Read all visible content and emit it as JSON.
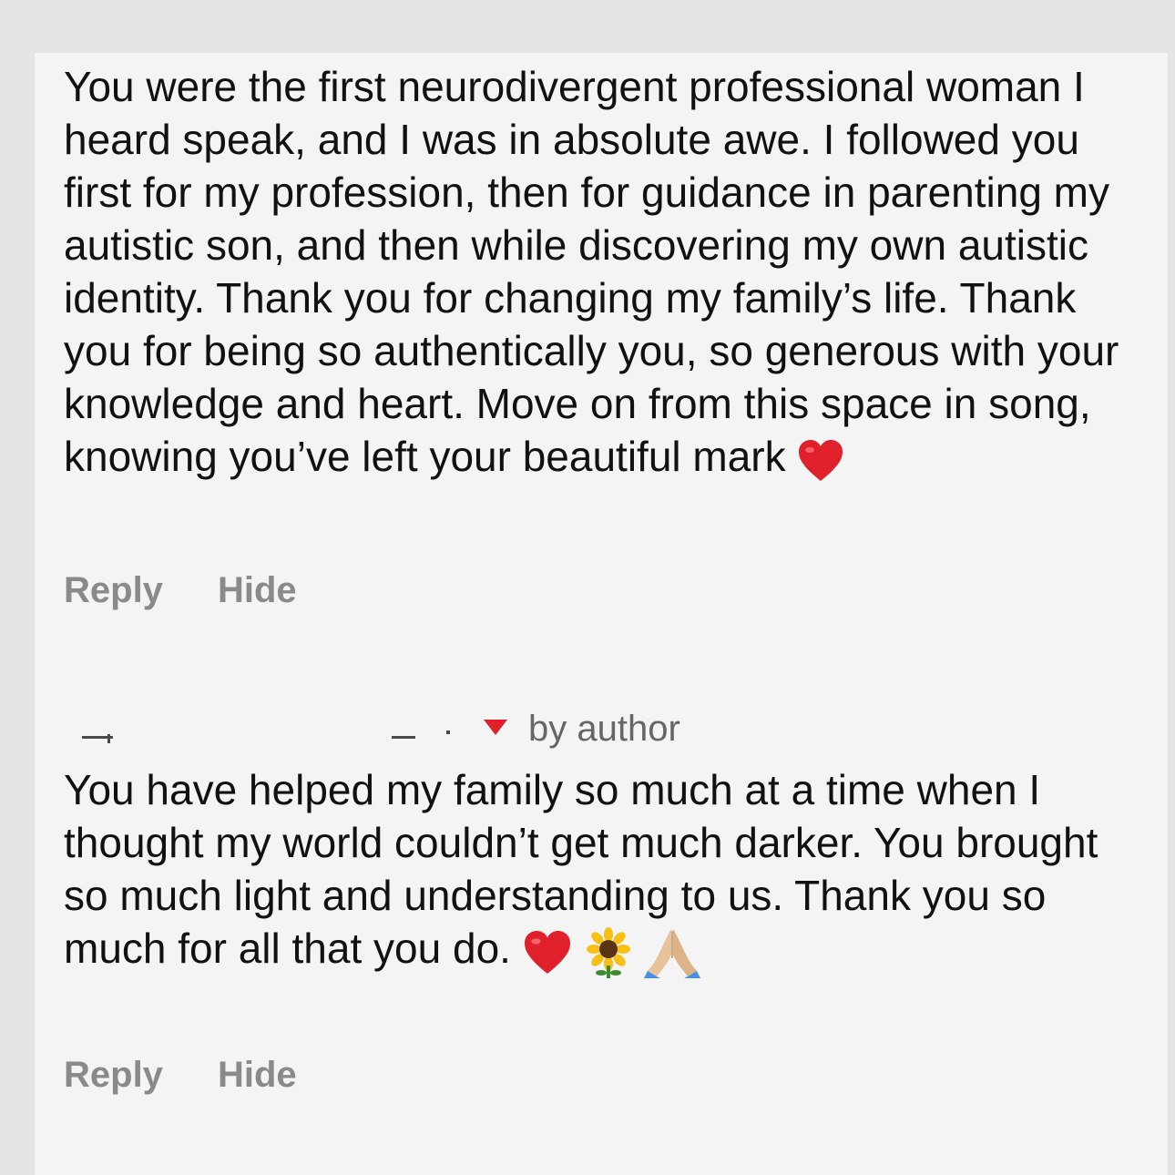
{
  "comments": [
    {
      "text": "You were the first neurodivergent professional woman I heard speak, and I was in absolute awe. I followed you first for my profession, then for guidance in parenting my autistic son, and then while discovering my own autistic identity. Thank you for changing my family’s life. Thank you for being so authentically you, so generous with your knowledge and heart. Move on from this space in song, knowing you’ve left your beautiful mark",
      "emojis": [
        "red-heart"
      ],
      "reply_label": "Reply",
      "hide_label": "Hide"
    },
    {
      "liked_by_label": "by author",
      "text": "You have helped my family so much at a time when I thought my world couldn’t get much darker. You brought so much light and understanding to us. Thank you so much for all that you do.",
      "emojis": [
        "red-heart",
        "sunflower",
        "folded-hands"
      ],
      "reply_label": "Reply",
      "hide_label": "Hide"
    }
  ],
  "colors": {
    "text": "#111111",
    "action": "#8a8a8a",
    "heart": "#e0202a",
    "background": "#f4f4f4"
  }
}
